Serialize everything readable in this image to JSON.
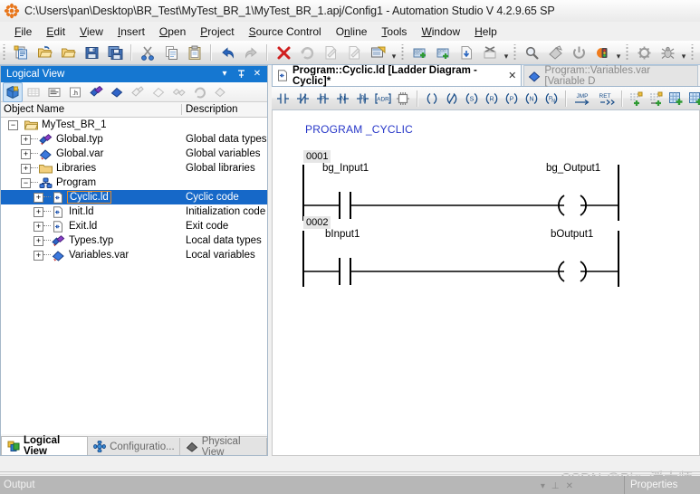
{
  "window": {
    "title": "C:\\Users\\pan\\Desktop\\BR_Test\\MyTest_BR_1\\MyTest_BR_1.apj/Config1  -  Automation Studio V 4.2.9.65 SP",
    "logo_icon": "automation-studio-logo-icon"
  },
  "menubar": {
    "items": [
      {
        "label": "File",
        "accel": "F"
      },
      {
        "label": "Edit",
        "accel": "E"
      },
      {
        "label": "View",
        "accel": "V"
      },
      {
        "label": "Insert",
        "accel": "I"
      },
      {
        "label": "Open",
        "accel": "O"
      },
      {
        "label": "Project",
        "accel": "P"
      },
      {
        "label": "Source Control",
        "accel": "S"
      },
      {
        "label": "Online",
        "accel": "n"
      },
      {
        "label": "Tools",
        "accel": "T"
      },
      {
        "label": "Window",
        "accel": "W"
      },
      {
        "label": "Help",
        "accel": "H"
      }
    ]
  },
  "toolbar": {
    "groups": [
      {
        "buttons": [
          {
            "icon": "new-project-icon",
            "label": "New Project"
          },
          {
            "icon": "open-project-icon",
            "label": "Open Project"
          },
          {
            "icon": "open-folder-icon",
            "label": "Open"
          },
          {
            "icon": "save-icon",
            "label": "Save"
          },
          {
            "icon": "save-all-icon",
            "label": "Save All"
          }
        ]
      },
      {
        "buttons": [
          {
            "icon": "cut-scissors-icon",
            "label": "Cut"
          },
          {
            "icon": "copy-icon",
            "label": "Copy"
          },
          {
            "icon": "paste-icon",
            "label": "Paste"
          }
        ]
      },
      {
        "buttons": [
          {
            "icon": "undo-arrow-icon",
            "label": "Undo"
          },
          {
            "icon": "redo-arrow-icon",
            "label": "Redo"
          }
        ]
      },
      {
        "buttons": [
          {
            "icon": "delete-x-icon",
            "label": "Delete"
          },
          {
            "icon": "refresh-icon",
            "label": "Refresh"
          },
          {
            "icon": "page-edit-icon",
            "label": "Edit Page"
          },
          {
            "icon": "page-delete-icon",
            "label": "Delete Page"
          },
          {
            "icon": "properties-icon",
            "label": "Properties"
          }
        ]
      },
      {
        "buttons": [
          {
            "icon": "build-add-icon",
            "label": "Build"
          },
          {
            "icon": "rebuild-icon",
            "label": "Rebuild"
          },
          {
            "icon": "transfer-download-icon",
            "label": "Transfer"
          },
          {
            "icon": "build-cancel-icon",
            "label": "Stop Build"
          }
        ]
      },
      {
        "buttons": [
          {
            "icon": "search-magnifier-icon",
            "label": "Find"
          },
          {
            "icon": "online-connect-icon",
            "label": "Online"
          },
          {
            "icon": "power-icon",
            "label": "Power"
          },
          {
            "icon": "traffic-light-icon",
            "label": "Status"
          }
        ]
      },
      {
        "buttons": [
          {
            "icon": "watch-gear-icon",
            "label": "Watch"
          },
          {
            "icon": "debug-bug-icon",
            "label": "Debug"
          }
        ]
      },
      {
        "buttons": [
          {
            "icon": "window-blank-icon",
            "label": "Window"
          },
          {
            "icon": "window-out-icon",
            "label": "Detach"
          },
          {
            "icon": "window-in-icon",
            "label": "Attach"
          },
          {
            "icon": "window-close-icon",
            "label": "Close Window"
          }
        ]
      }
    ],
    "overflow_label": "▾"
  },
  "logical_view": {
    "caption": "Logical View",
    "caption_buttons": [
      {
        "icon": "chevron-down-icon",
        "glyph": "▾"
      },
      {
        "icon": "pin-icon",
        "glyph": "⊥"
      },
      {
        "icon": "close-icon",
        "glyph": "✕"
      }
    ],
    "toolbar_buttons": [
      {
        "icon": "object-cube-icon",
        "label": "Object"
      },
      {
        "icon": "table-grid-icon",
        "label": "Table"
      },
      {
        "icon": "text-lines-icon",
        "label": "Text"
      },
      {
        "icon": "header-h-icon",
        "label": ".h"
      },
      {
        "icon": "data-types-icon",
        "label": "Data Types"
      },
      {
        "icon": "variables-icon",
        "label": "Variables"
      },
      {
        "icon": "export-icon",
        "label": "Export"
      },
      {
        "icon": "page-blank-icon",
        "label": "Page"
      },
      {
        "icon": "link-icon",
        "label": "Link"
      },
      {
        "icon": "refresh-round-icon",
        "label": "Refresh"
      },
      {
        "icon": "diamond-icon",
        "label": "Other"
      }
    ],
    "columns": [
      "Object Name",
      "Description"
    ],
    "tree": [
      {
        "name": "MyTest_BR_1",
        "desc": "",
        "depth": 0,
        "expander": "minus",
        "icon": "folder-icon",
        "selected": false
      },
      {
        "name": "Global.typ",
        "desc": "Global data types",
        "depth": 1,
        "expander": "plus",
        "icon": "data-types-icon",
        "selected": false
      },
      {
        "name": "Global.var",
        "desc": "Global variables",
        "depth": 1,
        "expander": "plus",
        "icon": "variables-icon",
        "selected": false
      },
      {
        "name": "Libraries",
        "desc": "Global libraries",
        "depth": 1,
        "expander": "plus",
        "icon": "folder-icon",
        "selected": false
      },
      {
        "name": "Program",
        "desc": "",
        "depth": 1,
        "expander": "minus",
        "icon": "program-icon",
        "selected": false
      },
      {
        "name": "Cyclic.ld",
        "desc": "Cyclic code",
        "depth": 2,
        "expander": "plus",
        "icon": "ladder-file-icon",
        "selected": true
      },
      {
        "name": "Init.ld",
        "desc": "Initialization code",
        "depth": 2,
        "expander": "plus",
        "icon": "ladder-file-icon",
        "selected": false
      },
      {
        "name": "Exit.ld",
        "desc": "Exit code",
        "depth": 2,
        "expander": "plus",
        "icon": "ladder-file-icon",
        "selected": false
      },
      {
        "name": "Types.typ",
        "desc": "Local data types",
        "depth": 2,
        "expander": "plus",
        "icon": "data-types-icon",
        "selected": false
      },
      {
        "name": "Variables.var",
        "desc": "Local variables",
        "depth": 2,
        "expander": "plus",
        "icon": "variables-icon",
        "selected": false
      }
    ],
    "bottom_tabs": [
      {
        "label": "Logical View",
        "icon": "logical-view-icon",
        "active": true
      },
      {
        "label": "Configuratio...",
        "icon": "configuration-view-icon",
        "active": false
      },
      {
        "label": "Physical View",
        "icon": "physical-view-icon",
        "active": false
      }
    ]
  },
  "editor": {
    "tabs": [
      {
        "label": "Program::Cyclic.ld [Ladder Diagram - Cyclic]*",
        "icon": "ladder-file-icon",
        "active": true,
        "close_glyph": "✕"
      },
      {
        "label": "Program::Variables.var [Variable D",
        "icon": "variables-icon",
        "active": false,
        "close_glyph": ""
      }
    ],
    "ld_toolbar": [
      {
        "icon": "contact-no-icon",
        "label": "Normally Open Contact",
        "glyph": "contact-no"
      },
      {
        "icon": "contact-nc-icon",
        "label": "Normally Closed Contact",
        "glyph": "contact-nc"
      },
      {
        "icon": "contact-p-icon",
        "label": "Positive Edge Contact",
        "glyph": "contact-p"
      },
      {
        "icon": "contact-n-icon",
        "label": "Negative Edge Contact",
        "glyph": "contact-n"
      },
      {
        "icon": "contact-pn-icon",
        "label": "Edge Contact",
        "glyph": "contact-pn"
      },
      {
        "icon": "address-adr-icon",
        "label": "Address",
        "glyph": "ADR"
      },
      {
        "icon": "function-block-icon",
        "label": "Function Block",
        "glyph": "fb"
      },
      {
        "sep": true
      },
      {
        "icon": "coil-icon",
        "label": "Coil",
        "glyph": "( )"
      },
      {
        "icon": "coil-negated-icon",
        "label": "Negated Coil",
        "glyph": "(/)"
      },
      {
        "icon": "coil-set-icon",
        "label": "Set Coil",
        "glyph": "(S)"
      },
      {
        "icon": "coil-reset-icon",
        "label": "Reset Coil",
        "glyph": "(R)"
      },
      {
        "icon": "coil-positive-icon",
        "label": "Positive Coil",
        "glyph": "(P)"
      },
      {
        "icon": "coil-negative-icon",
        "label": "Negative Coil",
        "glyph": "(N)"
      },
      {
        "icon": "coil-pn-icon",
        "label": "Edge Coil",
        "glyph": "(N)"
      },
      {
        "sep": true
      },
      {
        "icon": "jump-icon",
        "label": "Jump",
        "glyph": "JMP"
      },
      {
        "icon": "return-icon",
        "label": "Return",
        "glyph": "RET"
      },
      {
        "sep": true
      },
      {
        "icon": "insert-rung-icon",
        "label": "Insert Rung"
      },
      {
        "icon": "append-rung-icon",
        "label": "Append Rung"
      },
      {
        "icon": "insert-network-icon",
        "label": "Insert Network"
      },
      {
        "icon": "append-network-icon",
        "label": "Append Network"
      },
      {
        "icon": "branch-icon",
        "label": "Branch"
      }
    ]
  },
  "ladder": {
    "program_title": "PROGRAM _CYCLIC",
    "rungs": [
      {
        "number": "0001",
        "input": "bg_Input1",
        "output": "bg_Output1"
      },
      {
        "number": "0002",
        "input": "bInput1",
        "output": "bOutput1"
      }
    ]
  },
  "output_panel": {
    "caption": "Output",
    "controls": [
      {
        "icon": "chevron-down-icon",
        "glyph": "▾"
      },
      {
        "icon": "pin-icon",
        "glyph": "⊥"
      },
      {
        "icon": "close-icon",
        "glyph": "✕"
      }
    ],
    "properties_label": "Properties"
  },
  "watermark": {
    "text": "CSDN @Big_潘大师"
  },
  "colors": {
    "caption_blue": "#1577d1",
    "selection_blue": "#1668c8",
    "program_text": "#2636c8",
    "ladder_line": "#000000",
    "ld_icon_blue": "#1b4f8a"
  }
}
